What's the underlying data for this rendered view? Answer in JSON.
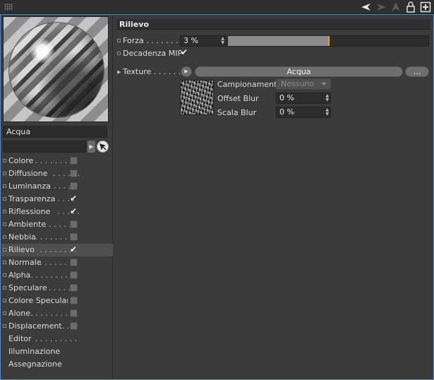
{
  "material": {
    "name": "Acqua"
  },
  "channels": [
    {
      "label": "Colore",
      "dots": " . . . . . . . .",
      "checked": false,
      "active": false,
      "has_box": true,
      "has_dot": true
    },
    {
      "label": "Diffusione",
      "dots": " . . . . . .",
      "checked": false,
      "active": false,
      "has_box": true,
      "has_dot": true
    },
    {
      "label": "Luminanza",
      "dots": " . . . . .",
      "checked": false,
      "active": false,
      "has_box": true,
      "has_dot": true
    },
    {
      "label": "Trasparenza",
      "dots": " . . . .",
      "checked": true,
      "active": false,
      "has_box": true,
      "has_dot": true
    },
    {
      "label": "Riflessione",
      "dots": " . . . . .",
      "checked": true,
      "active": false,
      "has_box": true,
      "has_dot": true
    },
    {
      "label": "Ambiente",
      "dots": " . . . . . .",
      "checked": false,
      "active": false,
      "has_box": true,
      "has_dot": true
    },
    {
      "label": "Nebbia",
      "dots": " . . . . . . . .",
      "checked": false,
      "active": false,
      "has_box": true,
      "has_dot": true
    },
    {
      "label": "Rilievo",
      "dots": " . . . . . . . .",
      "checked": true,
      "active": true,
      "has_box": true,
      "has_dot": true
    },
    {
      "label": "Normale",
      "dots": " . . . . . . .",
      "checked": false,
      "active": false,
      "has_box": true,
      "has_dot": true
    },
    {
      "label": "Alpha",
      "dots": " . . . . . . . . .",
      "checked": false,
      "active": false,
      "has_box": true,
      "has_dot": true
    },
    {
      "label": "Speculare",
      "dots": " . . . . . .",
      "checked": false,
      "active": false,
      "has_box": true,
      "has_dot": true
    },
    {
      "label": "Colore Speculare",
      "dots": "",
      "checked": false,
      "active": false,
      "has_box": true,
      "has_dot": true
    },
    {
      "label": "Alone",
      "dots": " . . . . . . . . .",
      "checked": false,
      "active": false,
      "has_box": true,
      "has_dot": true
    },
    {
      "label": "Displacement",
      "dots": " . . .",
      "checked": false,
      "active": false,
      "has_box": true,
      "has_dot": true
    },
    {
      "label": "Editor",
      "dots": " . . . . . . . . .",
      "checked": false,
      "active": false,
      "has_box": false,
      "has_dot": false
    },
    {
      "label": "Illuminazione",
      "dots": "",
      "checked": false,
      "active": false,
      "has_box": false,
      "has_dot": false
    },
    {
      "label": "Assegnazione",
      "dots": "",
      "checked": false,
      "active": false,
      "has_box": false,
      "has_dot": false
    }
  ],
  "panel": {
    "title": "Rilievo",
    "forza": {
      "label": "Forza",
      "dots": " . . . . . . . .",
      "value": "3 %",
      "fraction": 0.03
    },
    "decadenza": {
      "label": "Decadenza MIP",
      "checked": true
    },
    "texture": {
      "label": "Texture",
      "dots": " . . . . . .",
      "name": "Acqua",
      "more": "..."
    },
    "campionamento": {
      "label": "Campionamento",
      "value": "Nessuno"
    },
    "offset_blur": {
      "label": "Offset Blur",
      "value": "0 %"
    },
    "scala_blur": {
      "label": "Scala Blur",
      "value": "0 %"
    }
  },
  "icons": [
    "grip-icon",
    "arrow-back-icon",
    "arrow-forward-icon",
    "up-icon",
    "lock-icon",
    "new-window-icon"
  ]
}
